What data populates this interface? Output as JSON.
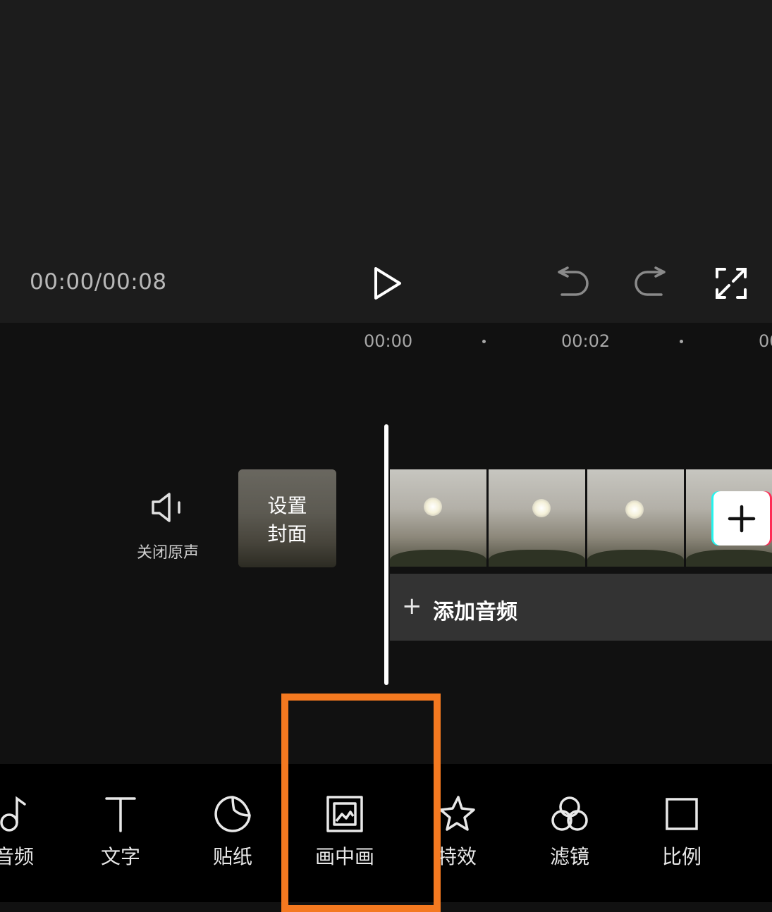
{
  "preview": {
    "time": "00:00/00:08",
    "controls": [
      "play-icon",
      "undo-icon",
      "redo-icon",
      "fullscreen-icon"
    ]
  },
  "ruler": {
    "ticks": [
      "00:00",
      "00:02",
      "00"
    ]
  },
  "track": {
    "mute_label": "关闭原声",
    "cover_line1": "设置",
    "cover_line2": "封面",
    "add_audio_plus": "+",
    "add_audio_label": "添加音频"
  },
  "toolbar": {
    "items": [
      {
        "label": "音频",
        "icon": "music-note-icon"
      },
      {
        "label": "文字",
        "icon": "text-icon"
      },
      {
        "label": "贴纸",
        "icon": "sticker-icon"
      },
      {
        "label": "画中画",
        "icon": "picture-in-picture-icon"
      },
      {
        "label": "特效",
        "icon": "effects-star-icon"
      },
      {
        "label": "滤镜",
        "icon": "filter-icon"
      },
      {
        "label": "比例",
        "icon": "ratio-icon"
      }
    ]
  },
  "colors": {
    "highlight": "#f47920",
    "background": "#111111",
    "toolbar_bg": "#000000",
    "audio_track": "#333333"
  }
}
